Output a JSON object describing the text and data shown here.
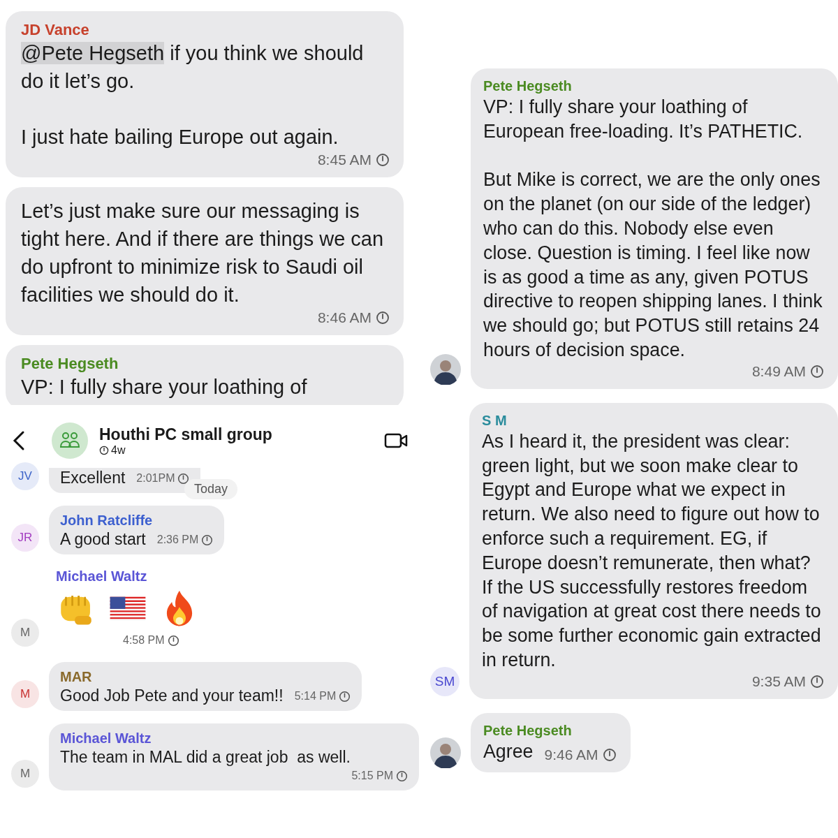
{
  "panels": [
    {
      "kind": "plain",
      "messages": [
        {
          "kind": "text",
          "sender": "JD Vance",
          "color": "#c7412c",
          "mention": "@Pete Hegseth",
          "text": " if you think we should do it let’s go.\n\nI just hate bailing Europe out again.",
          "time": "8:45 AM"
        },
        {
          "kind": "text",
          "text": "Let’s just make sure our messaging is tight here. And if there are things we can do upfront to minimize risk to Saudi oil facilities we should do it.",
          "time": "8:46 AM"
        },
        {
          "kind": "text",
          "sender": "Pete Hegseth",
          "color": "#4b8b22",
          "text": "VP: I fully share your loathing of"
        }
      ]
    },
    {
      "kind": "chat",
      "header": {
        "title": "Houthi PC small group",
        "timer": "4w"
      },
      "date_pill": "Today",
      "messages": [
        {
          "kind": "text",
          "avatar": {
            "kind": "initials",
            "initials": "JV",
            "color": "#3c63c8"
          },
          "text": "Excellent",
          "time": "2:01PM"
        },
        {
          "kind": "text",
          "avatar": {
            "kind": "initials",
            "initials": "JR",
            "color": "#a23cc0"
          },
          "sender": "John Ratcliffe",
          "color": "#3c5fcf",
          "text": "A good start",
          "time": "2:36 PM"
        },
        {
          "kind": "emoji",
          "avatar": {
            "kind": "initials",
            "initials": "M",
            "color": "#666666"
          },
          "sender": "Michael Waltz",
          "color": "#5a55d6",
          "time": "4:58 PM"
        },
        {
          "kind": "text",
          "avatar": {
            "kind": "initials",
            "initials": "M",
            "color": "#c83232"
          },
          "sender": "MAR",
          "color": "#8a6a2c",
          "text": "Good Job Pete and your team!!",
          "time": "5:14 PM"
        },
        {
          "kind": "text",
          "avatar": {
            "kind": "initials",
            "initials": "M",
            "color": "#666666"
          },
          "sender": "Michael Waltz",
          "color": "#5a55d6",
          "text": "The team in MAL did a great job  as well.",
          "time": "5:15 PM"
        }
      ]
    },
    {
      "kind": "chat",
      "messages": [
        {
          "kind": "text",
          "avatar": {
            "kind": "photo"
          },
          "sender": "Pete Hegseth",
          "color": "#4b8b22",
          "text": "VP: I fully share your loathing of European free-loading. It’s PATHETIC.\n\nBut Mike is correct, we are the only ones on the planet (on our side of the ledger) who can do this. Nobody else even close. Question is timing. I feel like now is as good a time as any, given POTUS directive to reopen shipping lanes. I think we should go; but POTUS still retains 24 hours of decision space.",
          "time": "8:49 AM"
        },
        {
          "kind": "text",
          "avatar": {
            "kind": "initials",
            "initials": "SM",
            "color": "#4a48d0"
          },
          "sender": "S M",
          "color": "#2a8c9c",
          "text": "As I heard it, the president was clear: green light, but we soon make clear to Egypt and Europe what we expect in return. We also need to figure out how to enforce such a requirement. EG, if Europe doesn’t remunerate, then what? If the US successfully restores freedom of navigation at great cost there needs to be some further economic gain extracted in return.",
          "time": "9:35 AM"
        },
        {
          "kind": "text",
          "avatar": {
            "kind": "photo"
          },
          "sender": "Pete Hegseth",
          "color": "#4b8b22",
          "text": "Agree",
          "time": "9:46 AM"
        }
      ]
    }
  ]
}
